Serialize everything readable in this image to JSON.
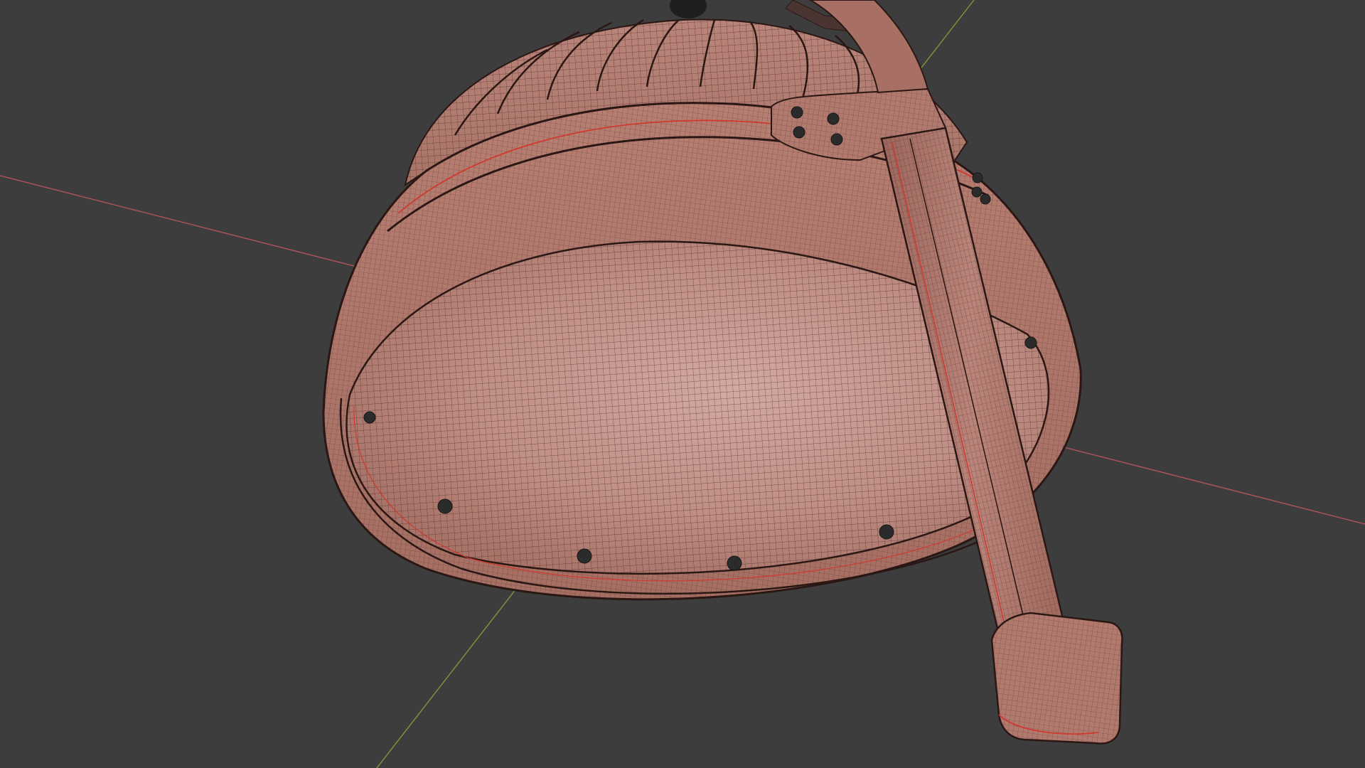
{
  "viewport": {
    "background_color": "#3d3d3d",
    "x_axis_color": "#b0545d",
    "y_axis_color": "#7a9a3c",
    "mesh_color": "#b27a6e",
    "wire_color": "#3a1f1b",
    "seam_color": "#d0392f"
  },
  "object": {
    "type": "helmet-wireframe",
    "components": [
      "dome",
      "brim-band",
      "inner-shell",
      "cheek-strap",
      "top-knob"
    ]
  }
}
